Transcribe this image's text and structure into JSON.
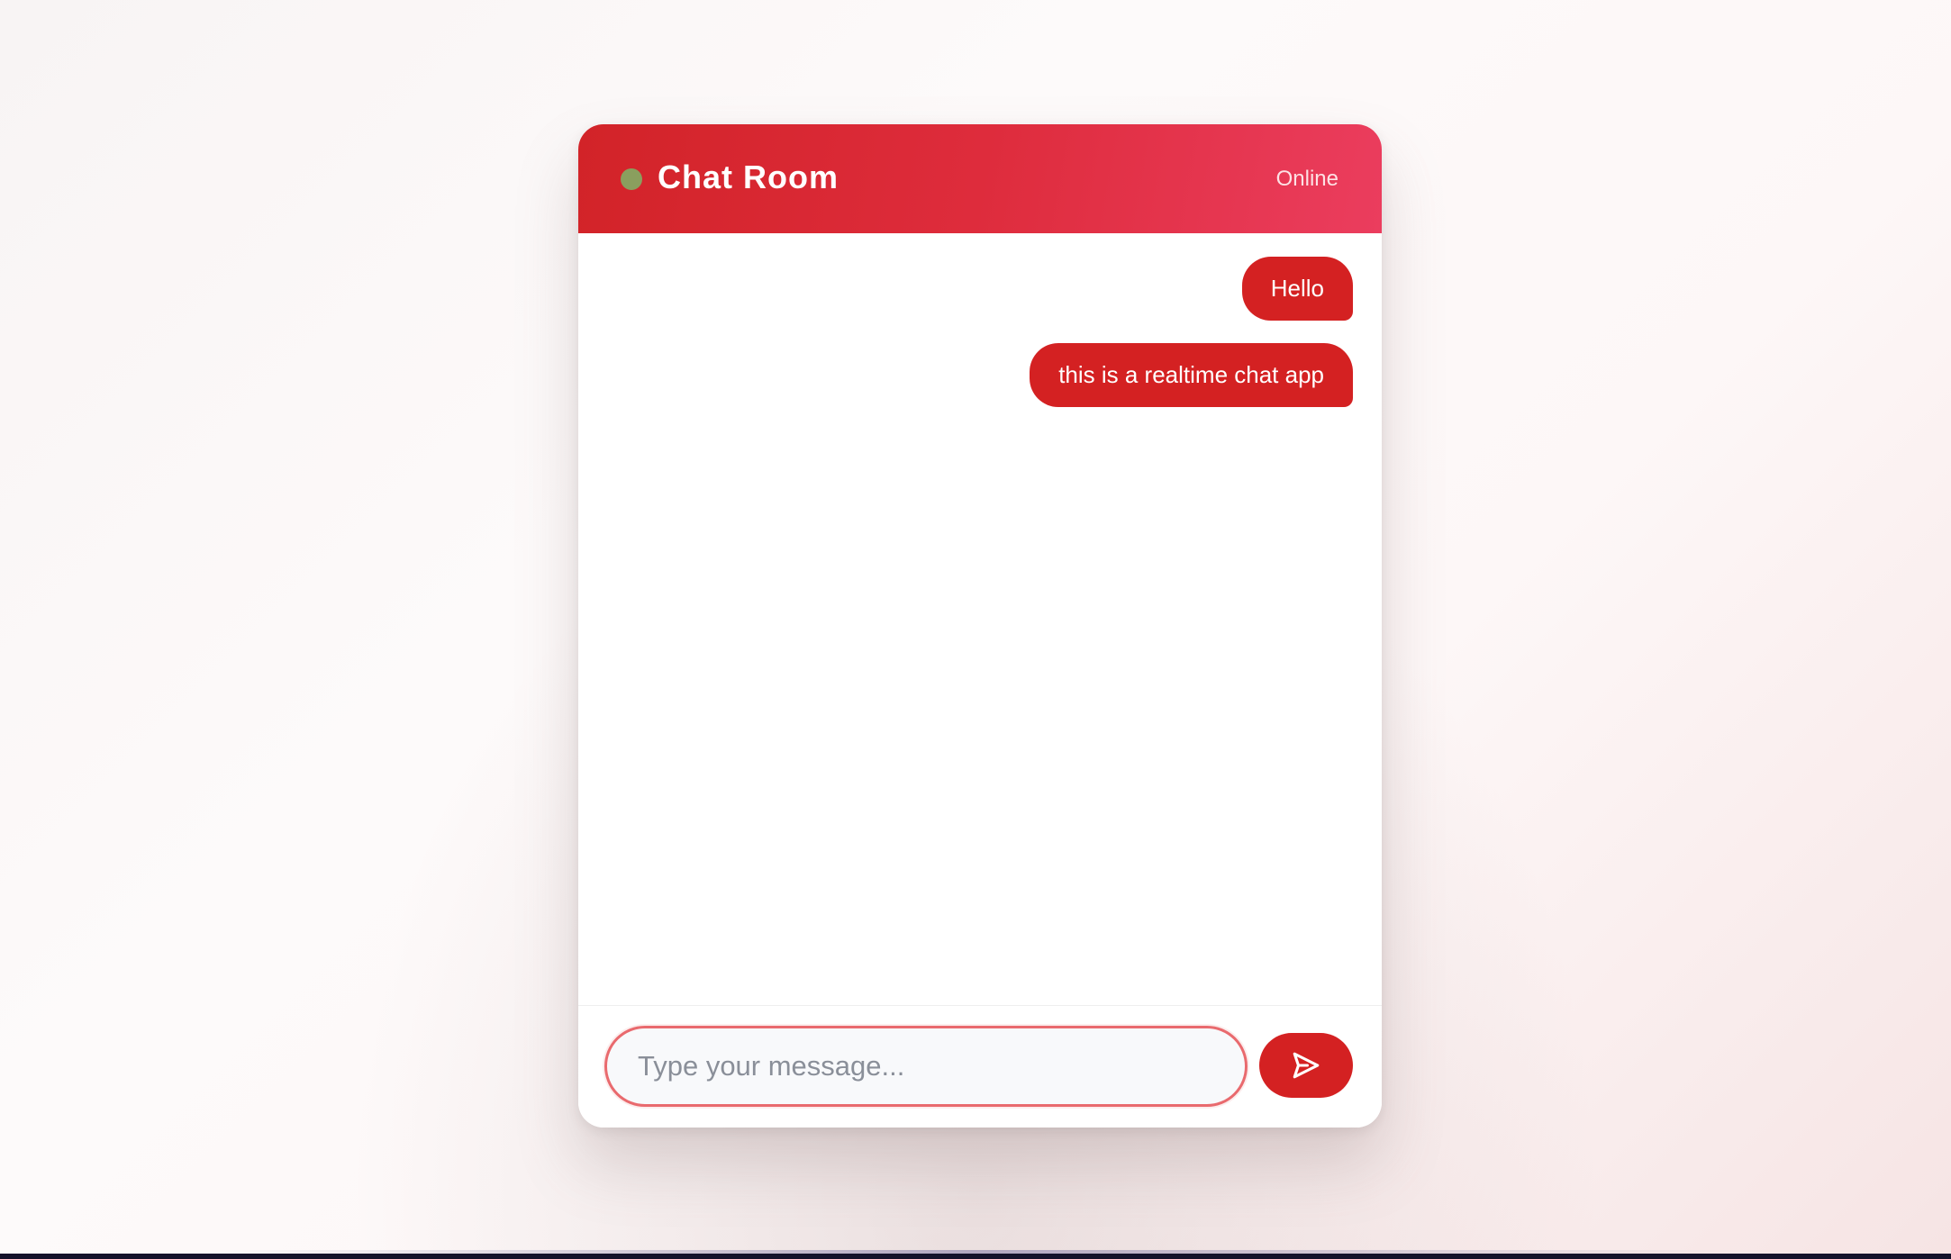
{
  "header": {
    "title": "Chat Room",
    "status": "Online"
  },
  "messages": [
    {
      "text": "Hello",
      "direction": "outgoing"
    },
    {
      "text": "this is a realtime chat app",
      "direction": "outgoing"
    }
  ],
  "composer": {
    "placeholder": "Type your message...",
    "value": "",
    "send_icon": "send-icon"
  },
  "colors": {
    "accent": "#d42122",
    "header_gradient_start": "#d22328",
    "header_gradient_end": "#eb3d5e",
    "status_dot": "#8a9f5e",
    "input_border": "#e96a6e"
  }
}
